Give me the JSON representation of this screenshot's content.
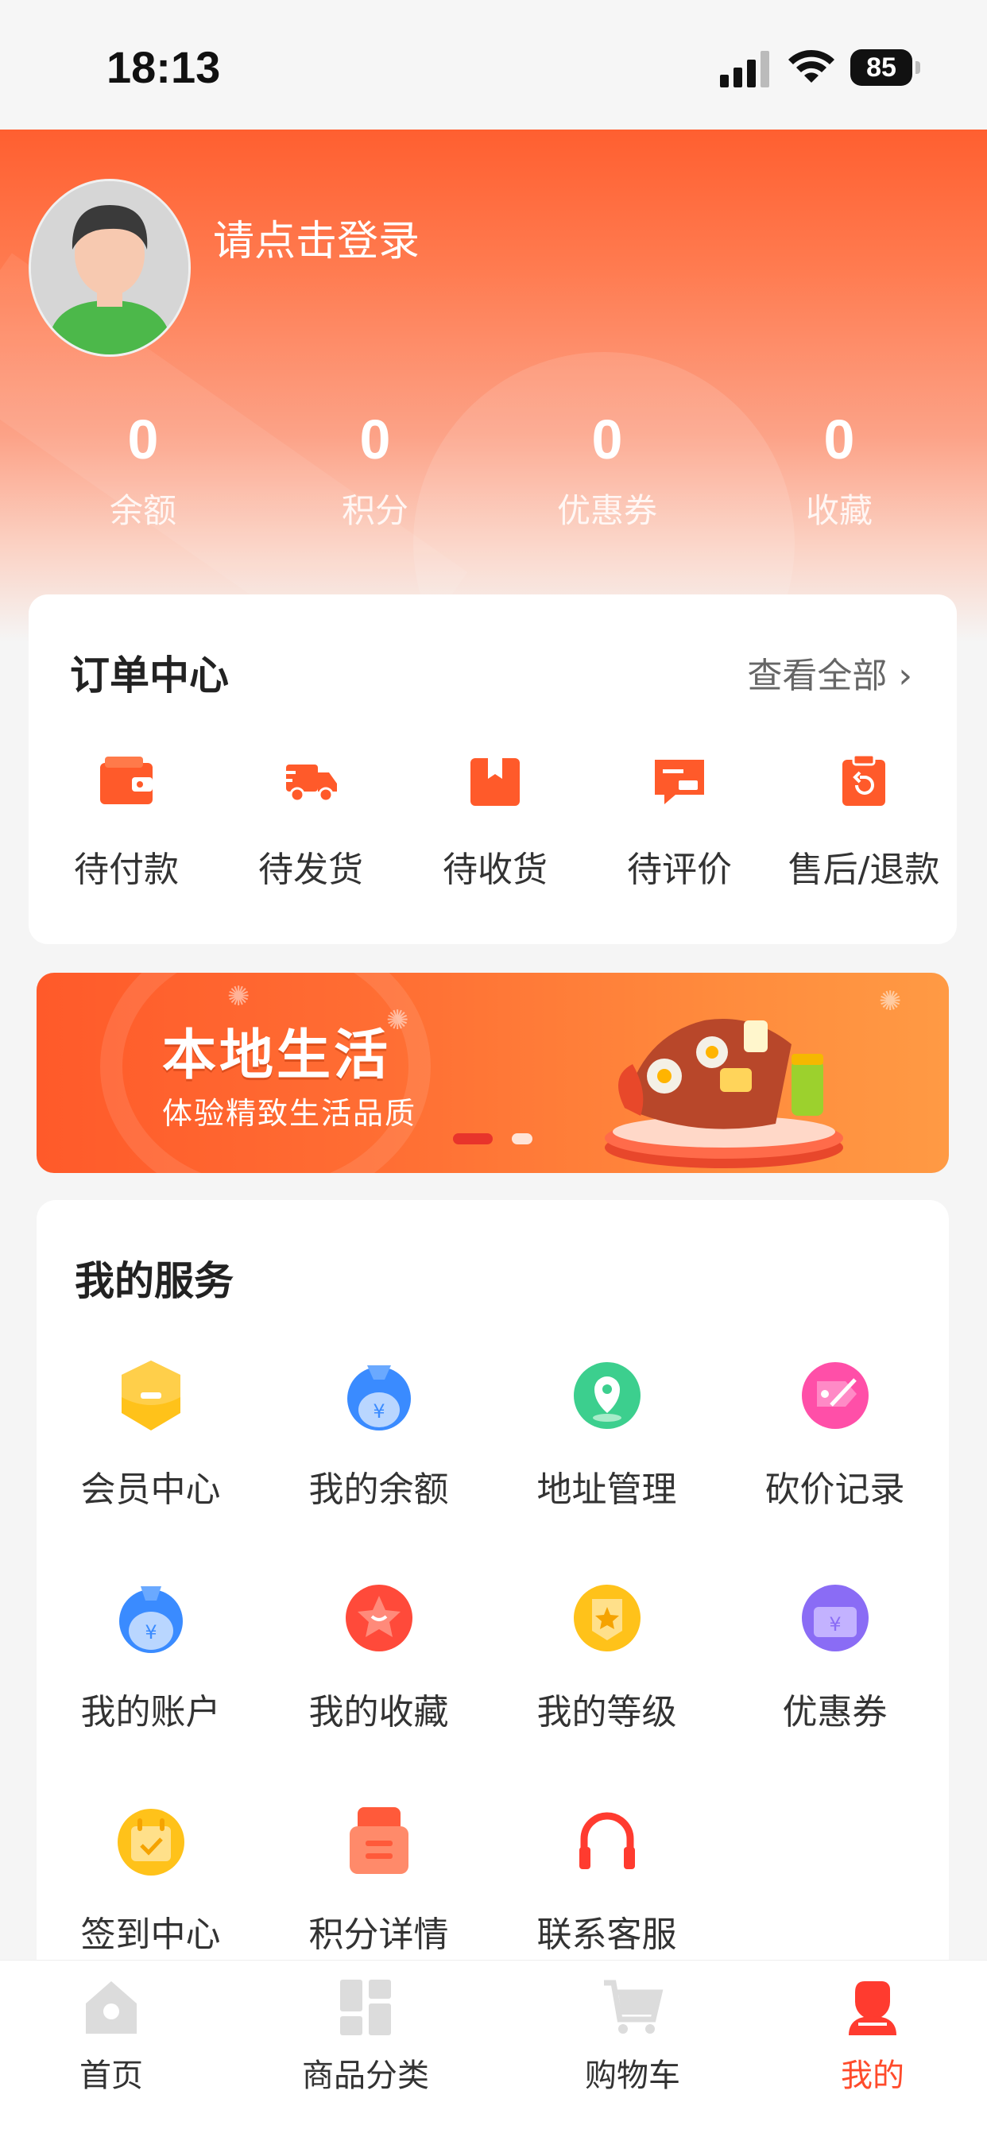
{
  "status_bar": {
    "time": "18:13",
    "battery": "85"
  },
  "header": {
    "login_text": "请点击登录",
    "stats": [
      {
        "value": "0",
        "label": "余额"
      },
      {
        "value": "0",
        "label": "积分"
      },
      {
        "value": "0",
        "label": "优惠券"
      },
      {
        "value": "0",
        "label": "收藏"
      }
    ]
  },
  "order_center": {
    "title": "订单中心",
    "view_all": "查看全部",
    "items": [
      {
        "label": "待付款",
        "icon": "wallet-icon"
      },
      {
        "label": "待发货",
        "icon": "truck-icon"
      },
      {
        "label": "待收货",
        "icon": "package-icon"
      },
      {
        "label": "待评价",
        "icon": "comment-icon"
      },
      {
        "label": "售后/退款",
        "icon": "refund-icon"
      }
    ]
  },
  "banner": {
    "title": "本地生活",
    "subtitle": "体验精致生活品质",
    "slide_index": 1,
    "slide_count": 2
  },
  "services": {
    "title": "我的服务",
    "items": [
      {
        "label": "会员中心",
        "icon": "member-icon",
        "color": "#ffc21a"
      },
      {
        "label": "我的余额",
        "icon": "money-bag-icon",
        "color": "#3a8bff"
      },
      {
        "label": "地址管理",
        "icon": "location-icon",
        "color": "#3ccf8e"
      },
      {
        "label": "砍价记录",
        "icon": "bargain-tag-icon",
        "color": "#ff4fa8"
      },
      {
        "label": "我的账户",
        "icon": "account-icon",
        "color": "#3a8bff"
      },
      {
        "label": "我的收藏",
        "icon": "favorite-star-icon",
        "color": "#ff4a3a"
      },
      {
        "label": "我的等级",
        "icon": "level-badge-icon",
        "color": "#ffc21a"
      },
      {
        "label": "优惠券",
        "icon": "coupon-icon",
        "color": "#8a6cf5"
      },
      {
        "label": "签到中心",
        "icon": "calendar-check-icon",
        "color": "#ffc21a"
      },
      {
        "label": "积分详情",
        "icon": "points-detail-icon",
        "color": "#ff5a3a"
      },
      {
        "label": "联系客服",
        "icon": "headset-icon",
        "color": "#ff3b2f"
      }
    ]
  },
  "tabbar": {
    "tabs": [
      {
        "label": "首页",
        "icon": "home-icon",
        "active": false
      },
      {
        "label": "商品分类",
        "icon": "category-icon",
        "active": false
      },
      {
        "label": "购物车",
        "icon": "cart-icon",
        "active": false
      },
      {
        "label": "我的",
        "icon": "profile-icon",
        "active": true
      }
    ]
  },
  "colors": {
    "brand": "#ff5a2a",
    "active_tab": "#ff4b2b"
  }
}
